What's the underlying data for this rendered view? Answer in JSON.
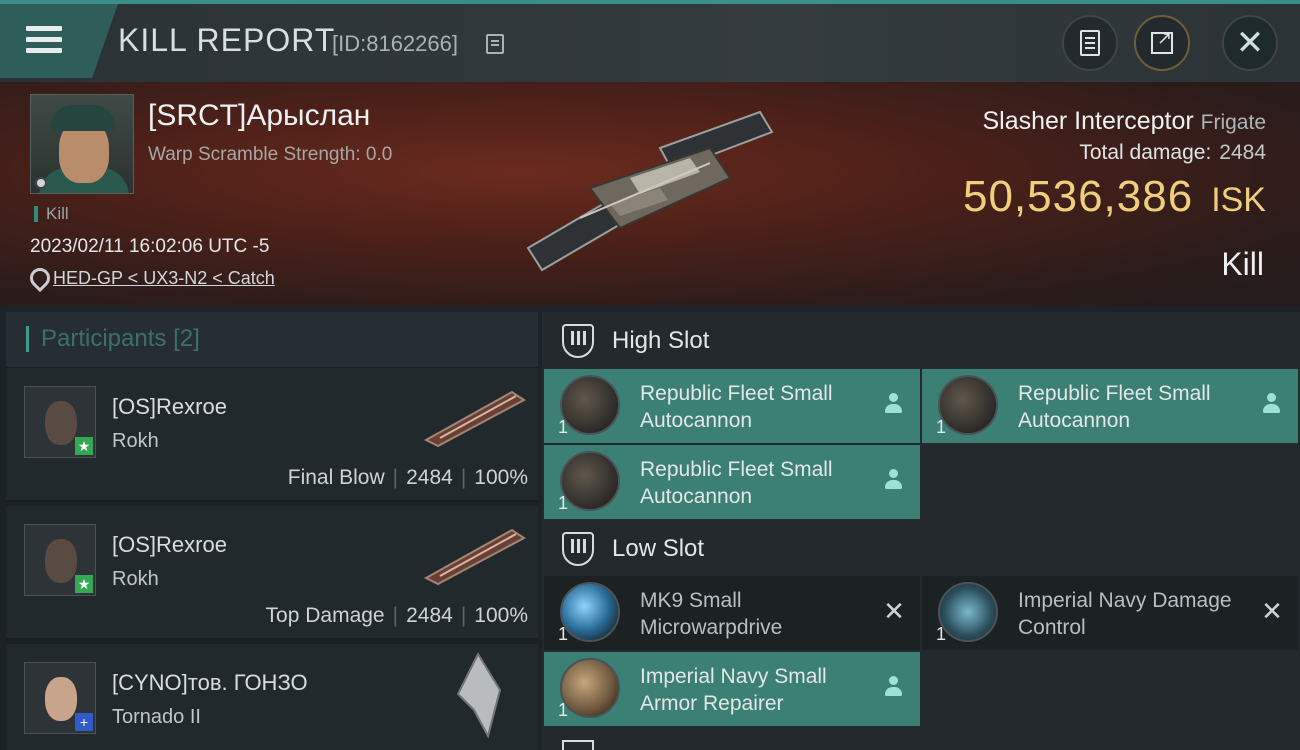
{
  "header": {
    "title": "KILL REPORT",
    "report_id": "[ID:8162266]"
  },
  "victim": {
    "name": "[SRCT]Арыслан",
    "warp_scramble": "Warp Scramble Strength: 0.0",
    "type_tag": "Kill",
    "datetime": "2023/02/11 16:02:06 UTC -5",
    "location": "HED-GP < UX3-N2 < Catch",
    "ship_name": "Slasher Interceptor",
    "ship_class": "Frigate",
    "total_damage_label": "Total damage:",
    "total_damage": "2484",
    "isk_value": "50,536,386",
    "isk_unit": "ISK",
    "result": "Kill"
  },
  "participants": {
    "title": "Participants",
    "count": "[2]",
    "rows": [
      {
        "name": "[OS]Rexroe",
        "ship": "Rokh",
        "role": "Final Blow",
        "damage": "2484",
        "percent": "100%"
      },
      {
        "name": "[OS]Rexroe",
        "ship": "Rokh",
        "role": "Top Damage",
        "damage": "2484",
        "percent": "100%"
      },
      {
        "name": "[CYNO]тов. ГОНЗО",
        "ship": "Tornado II"
      }
    ]
  },
  "fitting": {
    "high_slot_label": "High Slot",
    "low_slot_label": "Low Slot",
    "high": [
      {
        "qty": "1",
        "name": "Republic Fleet Small Autocannon"
      },
      {
        "qty": "1",
        "name": "Republic Fleet Small Autocannon"
      },
      {
        "qty": "1",
        "name": "Republic Fleet Small Autocannon"
      }
    ],
    "low": [
      {
        "qty": "1",
        "name": "MK9 Small Microwarpdrive"
      },
      {
        "qty": "1",
        "name": "Imperial Navy Damage Control"
      },
      {
        "qty": "1",
        "name": "Imperial Navy Small Armor Repairer"
      }
    ]
  },
  "colors": {
    "accent": "#3b7f75",
    "isk": "#f0cf7c"
  }
}
